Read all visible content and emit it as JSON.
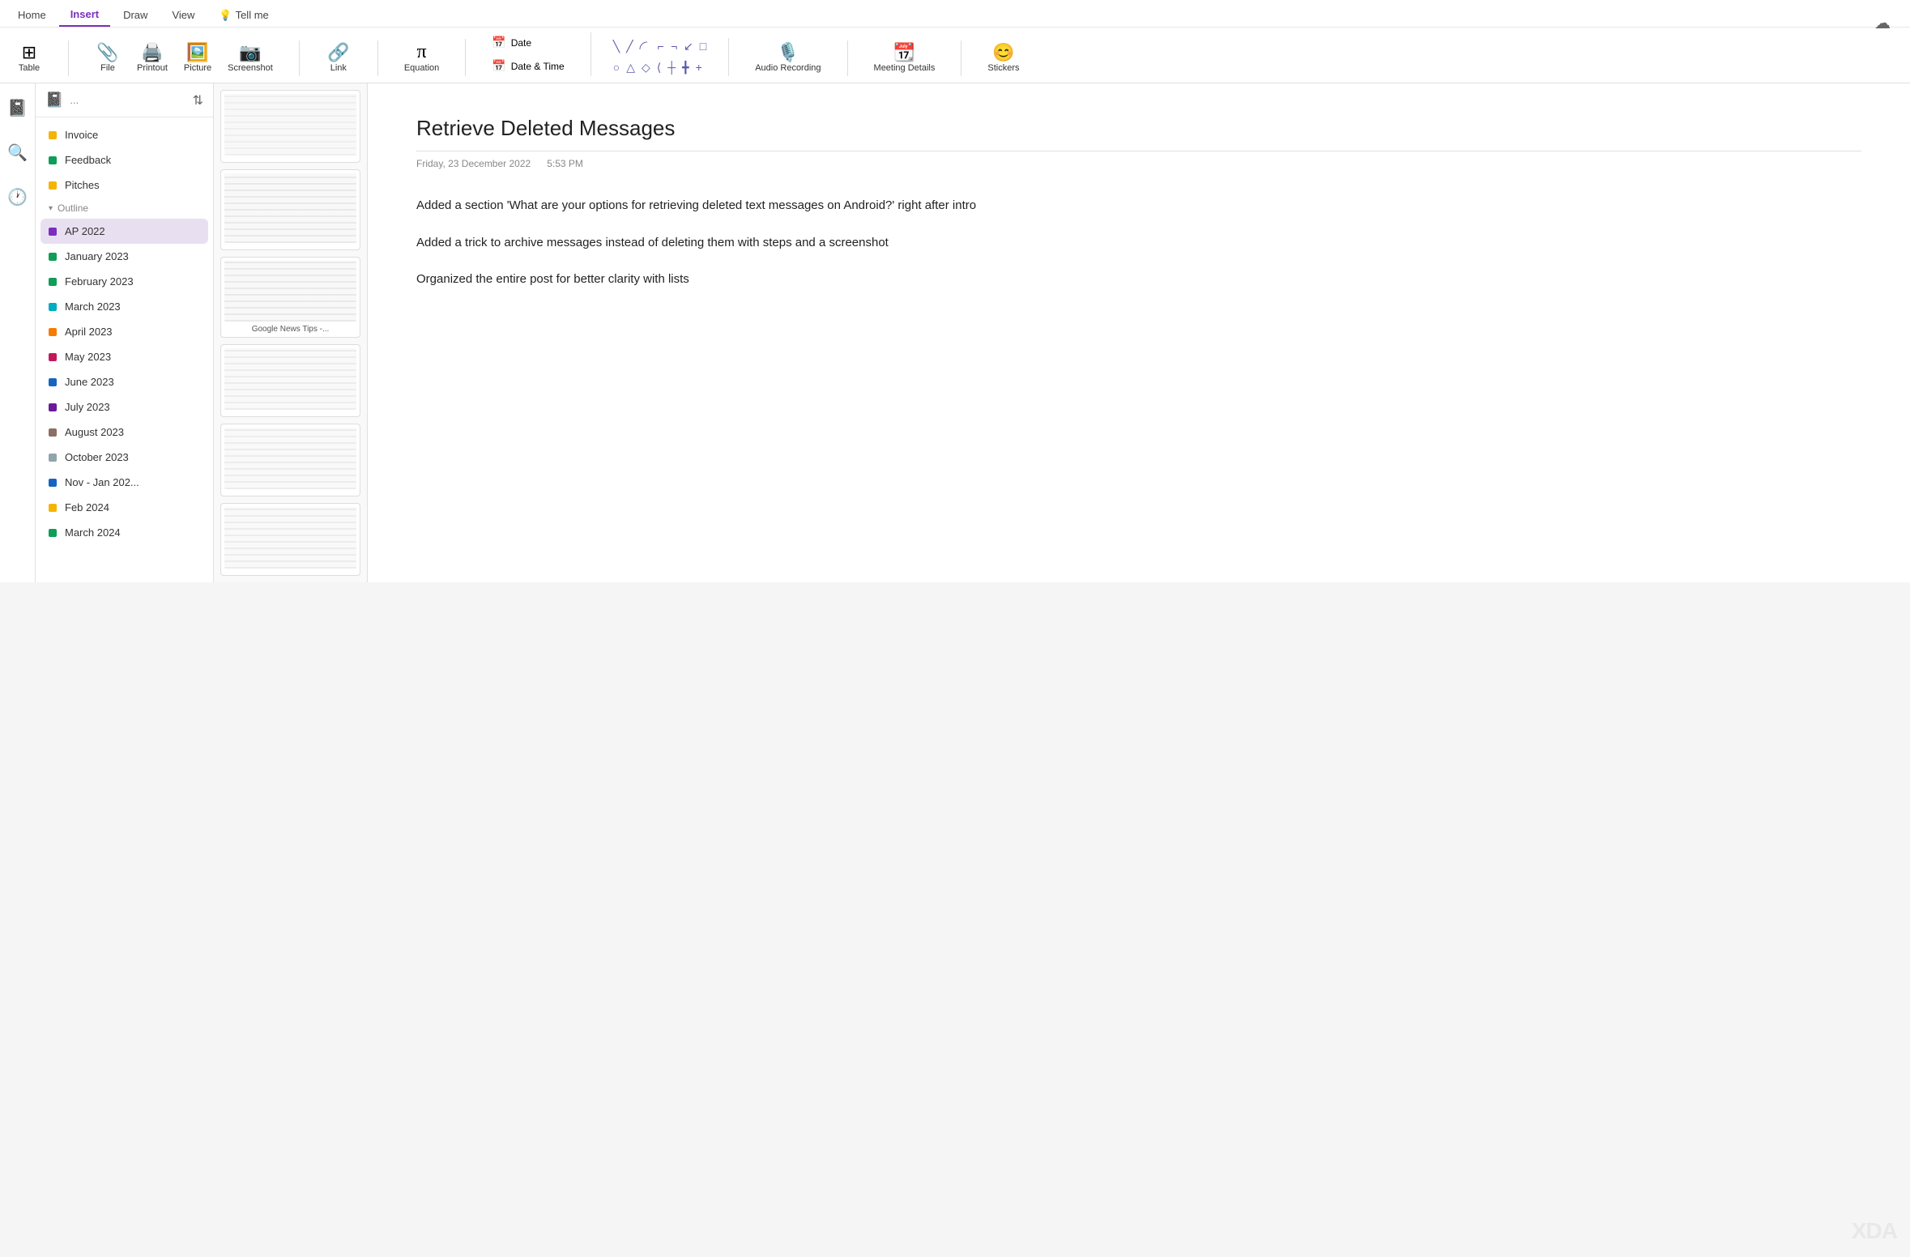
{
  "ribbon": {
    "tabs": [
      {
        "label": "Home",
        "active": false
      },
      {
        "label": "Insert",
        "active": true
      },
      {
        "label": "Draw",
        "active": false
      },
      {
        "label": "View",
        "active": false
      },
      {
        "label": "Tell me",
        "active": false,
        "icon": "💡"
      }
    ],
    "groups": {
      "table": {
        "label": "Table",
        "icon": "⊞"
      },
      "file": {
        "label": "File",
        "icon": "📎"
      },
      "printout": {
        "label": "Printout",
        "icon": "🖨"
      },
      "picture": {
        "label": "Picture",
        "icon": "🖼"
      },
      "screenshot": {
        "label": "Screenshot",
        "icon": "📷"
      },
      "link": {
        "label": "Link",
        "icon": "🔗"
      },
      "equation": {
        "label": "Equation",
        "icon": "π"
      },
      "date": {
        "label": "Date",
        "icon": "📅"
      },
      "datetime": {
        "label": "Date & Time",
        "icon": "📅"
      },
      "audio": {
        "label": "Audio Recording",
        "icon": "🎙"
      },
      "meeting": {
        "label": "Meeting Details",
        "icon": "📆"
      },
      "stickers": {
        "label": "Stickers",
        "icon": "😊"
      }
    },
    "shapes": {
      "row1": [
        "╲",
        "╱",
        "⌒",
        "⌐",
        "⌐",
        "⌐",
        "□"
      ],
      "row2": [
        "○",
        "△",
        "◇",
        "⟨",
        "┼",
        "┼",
        "┼"
      ]
    }
  },
  "sidebar": {
    "notebook_icon": "📓",
    "notebook_title": "...",
    "items": [
      {
        "label": "Invoice",
        "color": "#F4B400",
        "active": false
      },
      {
        "label": "Feedback",
        "color": "#0F9D58",
        "active": false
      },
      {
        "label": "Pitches",
        "color": "#F4B400",
        "active": false
      }
    ],
    "section": {
      "label": "Outline",
      "collapsed": false
    },
    "sub_items": [
      {
        "label": "AP 2022",
        "color": "#7B2FBE",
        "active": true
      },
      {
        "label": "January 2023",
        "color": "#0F9D58",
        "active": false
      },
      {
        "label": "February 2023",
        "color": "#0F9D58",
        "active": false
      },
      {
        "label": "March 2023",
        "color": "#00ACC1",
        "active": false
      },
      {
        "label": "April 2023",
        "color": "#F57C00",
        "active": false
      },
      {
        "label": "May 2023",
        "color": "#C2185B",
        "active": false
      },
      {
        "label": "June 2023",
        "color": "#1565C0",
        "active": false
      },
      {
        "label": "July 2023",
        "color": "#6A1B9A",
        "active": false
      },
      {
        "label": "August 2023",
        "color": "#8D6E63",
        "active": false
      },
      {
        "label": "October 2023",
        "color": "#90A4AE",
        "active": false
      },
      {
        "label": "Nov - Jan 202...",
        "color": "#1565C0",
        "active": false
      },
      {
        "label": "Feb 2024",
        "color": "#F4B400",
        "active": false
      },
      {
        "label": "March 2024",
        "color": "#0F9D58",
        "active": false
      }
    ]
  },
  "pages": [
    {
      "title": "Google News Tips -..."
    }
  ],
  "page": {
    "title": "Retrieve Deleted Messages",
    "date": "Friday, 23 December 2022",
    "time": "5:53 PM",
    "paragraphs": [
      "Added a section 'What are your options for retrieving deleted text messages on Android?' right after intro",
      "Added a trick to archive messages instead of deleting them with steps and a screenshot",
      "Organized the entire post for better clarity with lists"
    ]
  }
}
